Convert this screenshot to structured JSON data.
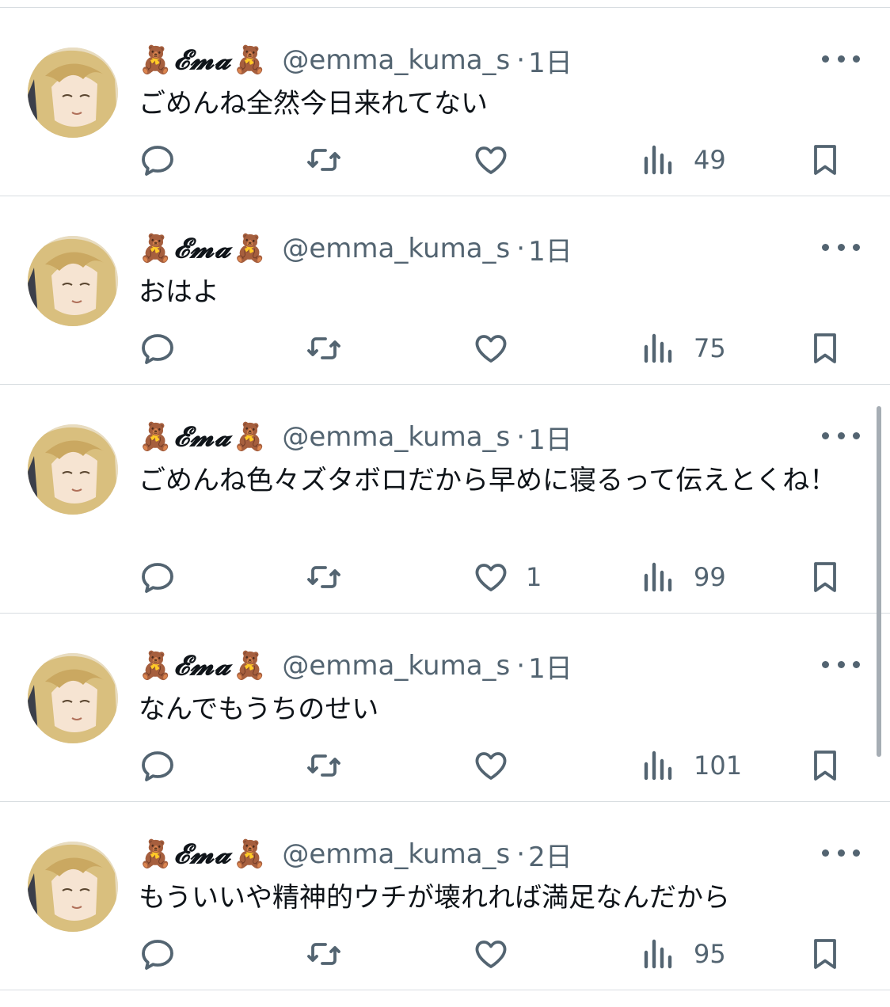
{
  "colors": {
    "text": "#0f1419",
    "muted": "#536471",
    "divider": "#d8dde1"
  },
  "tweets": [
    {
      "bear_left": "🧸",
      "display_name": "𝓔𝓶𝓪",
      "bear_right": "🧸",
      "handle": "@emma_kuma_s",
      "separator": "·",
      "time": "1日",
      "text": "ごめんね全然今日来れてない",
      "likes": "",
      "views": "49"
    },
    {
      "bear_left": "🧸",
      "display_name": "𝓔𝓶𝓪",
      "bear_right": "🧸",
      "handle": "@emma_kuma_s",
      "separator": "·",
      "time": "1日",
      "text": "おはよ",
      "likes": "",
      "views": "75"
    },
    {
      "bear_left": "🧸",
      "display_name": "𝓔𝓶𝓪",
      "bear_right": "🧸",
      "handle": "@emma_kuma_s",
      "separator": "·",
      "time": "1日",
      "text": "ごめんね色々ズタボロだから早めに寝るって伝えとくね！",
      "likes": "1",
      "views": "99"
    },
    {
      "bear_left": "🧸",
      "display_name": "𝓔𝓶𝓪",
      "bear_right": "🧸",
      "handle": "@emma_kuma_s",
      "separator": "·",
      "time": "1日",
      "text": "なんでもうちのせい",
      "likes": "",
      "views": "101"
    },
    {
      "bear_left": "🧸",
      "display_name": "𝓔𝓶𝓪",
      "bear_right": "🧸",
      "handle": "@emma_kuma_s",
      "separator": "·",
      "time": "2日",
      "text": "もういいや精神的ウチが壊れれば満足なんだから",
      "likes": "",
      "views": "95"
    }
  ],
  "icons": {
    "reply": "reply-icon",
    "retweet": "retweet-icon",
    "like": "heart-icon",
    "views": "views-icon",
    "bookmark": "bookmark-icon",
    "more": "more-icon"
  }
}
